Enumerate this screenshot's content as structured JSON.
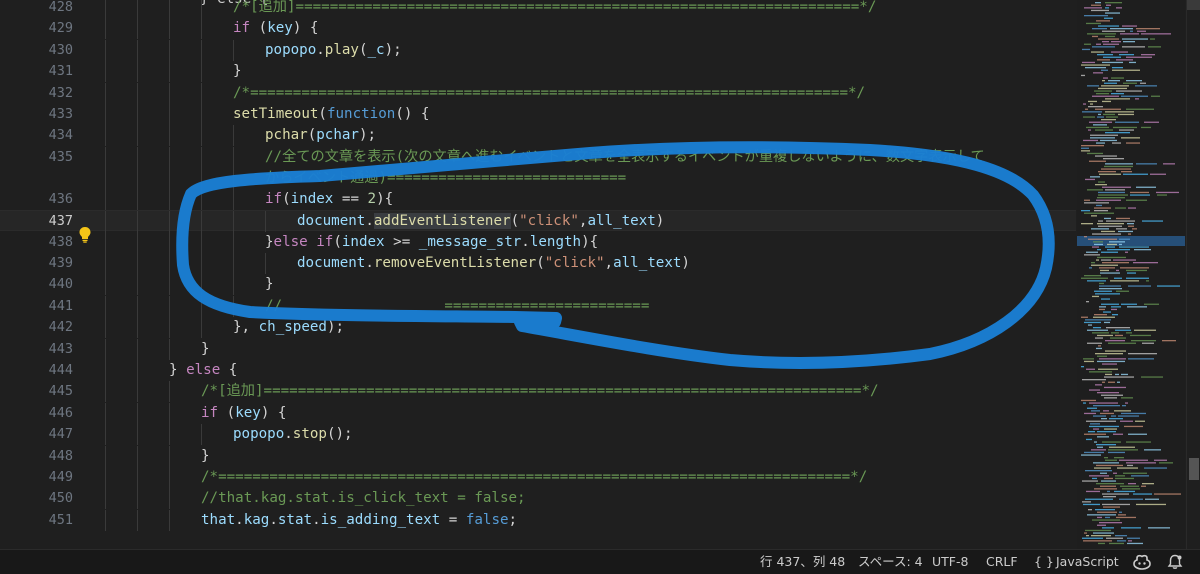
{
  "editor": {
    "lines": [
      {
        "n": "428",
        "kind": "code",
        "tokens": [
          {
            "c": "cm",
            "t": "/*[追加]==================================================================*/"
          }
        ]
      },
      {
        "n": "429",
        "kind": "code",
        "tokens": [
          {
            "c": "ctl",
            "t": "if"
          },
          {
            "c": "op",
            "t": " ("
          },
          {
            "c": "id",
            "t": "key"
          },
          {
            "c": "op",
            "t": ") {"
          }
        ]
      },
      {
        "n": "430",
        "kind": "code",
        "tokens": [
          {
            "c": "id",
            "t": "popopo"
          },
          {
            "c": "op",
            "t": "."
          },
          {
            "c": "fn",
            "t": "play"
          },
          {
            "c": "op",
            "t": "("
          },
          {
            "c": "id",
            "t": "_c"
          },
          {
            "c": "op",
            "t": ");"
          }
        ]
      },
      {
        "n": "431",
        "kind": "code",
        "tokens": [
          {
            "c": "op",
            "t": "}"
          }
        ]
      },
      {
        "n": "432",
        "kind": "code",
        "tokens": [
          {
            "c": "cm",
            "t": "/*======================================================================*/"
          }
        ]
      },
      {
        "n": "433",
        "kind": "code",
        "tokens": [
          {
            "c": "fn",
            "t": "setTimeout"
          },
          {
            "c": "op",
            "t": "("
          },
          {
            "c": "kw",
            "t": "function"
          },
          {
            "c": "op",
            "t": "() {"
          }
        ]
      },
      {
        "n": "434",
        "kind": "code",
        "tokens": [
          {
            "c": "fn",
            "t": "pchar"
          },
          {
            "c": "op",
            "t": "("
          },
          {
            "c": "id",
            "t": "pchar"
          },
          {
            "c": "op",
            "t": ");"
          }
        ]
      },
      {
        "n": "435",
        "kind": "code",
        "tokens": [
          {
            "c": "cm",
            "t": "//全ての文章を表示(次の文章へ進むイベントと文章を全表示するイベントが重複しないように、数文字表示して"
          }
        ]
      },
      {
        "n": "",
        "kind": "wrap",
        "tokens": [
          {
            "c": "cm",
            "t": "からイベント通過)============================"
          }
        ]
      },
      {
        "n": "436",
        "kind": "code",
        "tokens": [
          {
            "c": "ctl",
            "t": "if"
          },
          {
            "c": "op",
            "t": "("
          },
          {
            "c": "id",
            "t": "index"
          },
          {
            "c": "op",
            "t": " == "
          },
          {
            "c": "num",
            "t": "2"
          },
          {
            "c": "op",
            "t": "){"
          }
        ]
      },
      {
        "n": "437",
        "kind": "code",
        "tokens": [
          {
            "c": "id",
            "t": "document"
          },
          {
            "c": "op",
            "t": "."
          },
          {
            "c": "fn hl",
            "t": "addEventListener"
          },
          {
            "c": "op",
            "t": "("
          },
          {
            "c": "str",
            "t": "\"click\""
          },
          {
            "c": "op",
            "t": ","
          },
          {
            "c": "id",
            "t": "all_text"
          },
          {
            "c": "op",
            "t": ")"
          }
        ]
      },
      {
        "n": "438",
        "kind": "code",
        "tokens": [
          {
            "c": "op",
            "t": "}"
          },
          {
            "c": "ctl",
            "t": "else if"
          },
          {
            "c": "op",
            "t": "("
          },
          {
            "c": "id",
            "t": "index"
          },
          {
            "c": "op",
            "t": " >= "
          },
          {
            "c": "id",
            "t": "_message_str"
          },
          {
            "c": "op",
            "t": "."
          },
          {
            "c": "id",
            "t": "length"
          },
          {
            "c": "op",
            "t": "){"
          }
        ]
      },
      {
        "n": "439",
        "kind": "code",
        "tokens": [
          {
            "c": "id",
            "t": "document"
          },
          {
            "c": "op",
            "t": "."
          },
          {
            "c": "fn",
            "t": "removeEventListener"
          },
          {
            "c": "op",
            "t": "("
          },
          {
            "c": "str",
            "t": "\"click\""
          },
          {
            "c": "op",
            "t": ","
          },
          {
            "c": "id",
            "t": "all_text"
          },
          {
            "c": "op",
            "t": ")"
          }
        ]
      },
      {
        "n": "440",
        "kind": "code",
        "tokens": [
          {
            "c": "op",
            "t": "}"
          }
        ]
      },
      {
        "n": "441",
        "kind": "code",
        "tokens": [
          {
            "c": "cm",
            "t": "//"
          },
          {
            "c": "cm",
            "t": "                   "
          },
          {
            "c": "cm",
            "t": "========================"
          }
        ]
      },
      {
        "n": "442",
        "kind": "code",
        "tokens": [
          {
            "c": "op",
            "t": "}, "
          },
          {
            "c": "id",
            "t": "ch_speed"
          },
          {
            "c": "op",
            "t": ");"
          }
        ]
      },
      {
        "n": "443",
        "kind": "code",
        "tokens": [
          {
            "c": "op",
            "t": "}"
          }
        ]
      },
      {
        "n": "444",
        "kind": "code",
        "tokens": [
          {
            "c": "op",
            "t": "} "
          },
          {
            "c": "ctl",
            "t": "else"
          },
          {
            "c": "op",
            "t": " {"
          }
        ]
      },
      {
        "n": "445",
        "kind": "code",
        "tokens": [
          {
            "c": "cm",
            "t": "/*[追加]======================================================================*/"
          }
        ]
      },
      {
        "n": "446",
        "kind": "code",
        "tokens": [
          {
            "c": "ctl",
            "t": "if"
          },
          {
            "c": "op",
            "t": " ("
          },
          {
            "c": "id",
            "t": "key"
          },
          {
            "c": "op",
            "t": ") {"
          }
        ]
      },
      {
        "n": "447",
        "kind": "code",
        "tokens": [
          {
            "c": "id",
            "t": "popopo"
          },
          {
            "c": "op",
            "t": "."
          },
          {
            "c": "fn",
            "t": "stop"
          },
          {
            "c": "op",
            "t": "();"
          }
        ]
      },
      {
        "n": "448",
        "kind": "code",
        "tokens": [
          {
            "c": "op",
            "t": "}"
          }
        ]
      },
      {
        "n": "449",
        "kind": "code",
        "tokens": [
          {
            "c": "cm",
            "t": "/*==========================================================================*/"
          }
        ]
      },
      {
        "n": "450",
        "kind": "code",
        "tokens": [
          {
            "c": "cm",
            "t": "//that.kag.stat.is_click_text = false;"
          }
        ]
      },
      {
        "n": "451",
        "kind": "code",
        "tokens": [
          {
            "c": "id",
            "t": "that"
          },
          {
            "c": "op",
            "t": "."
          },
          {
            "c": "id",
            "t": "kag"
          },
          {
            "c": "op",
            "t": "."
          },
          {
            "c": "id",
            "t": "stat"
          },
          {
            "c": "op",
            "t": "."
          },
          {
            "c": "id",
            "t": "is_adding_text"
          },
          {
            "c": "op",
            "t": " = "
          },
          {
            "c": "kw",
            "t": "false"
          },
          {
            "c": "op",
            "t": ";"
          }
        ]
      }
    ],
    "active_line": "437",
    "partial_top_text": "} else {"
  },
  "statusbar": {
    "position": "行 437、列 48",
    "spaces": "スペース: 4",
    "encoding": "UTF-8",
    "eol": "CRLF",
    "language_icon": "{ }",
    "language": "JavaScript",
    "copilot_icon": "copilot-icon",
    "bell_icon": "bell-icon"
  },
  "colors": {
    "background": "#1f1f1f",
    "annotation": "#1a7fd4",
    "comment": "#6a9955",
    "keyword": "#569cd6",
    "control": "#c586c0",
    "function": "#dcdcaa",
    "identifier": "#9cdcfe",
    "string": "#ce9178"
  }
}
